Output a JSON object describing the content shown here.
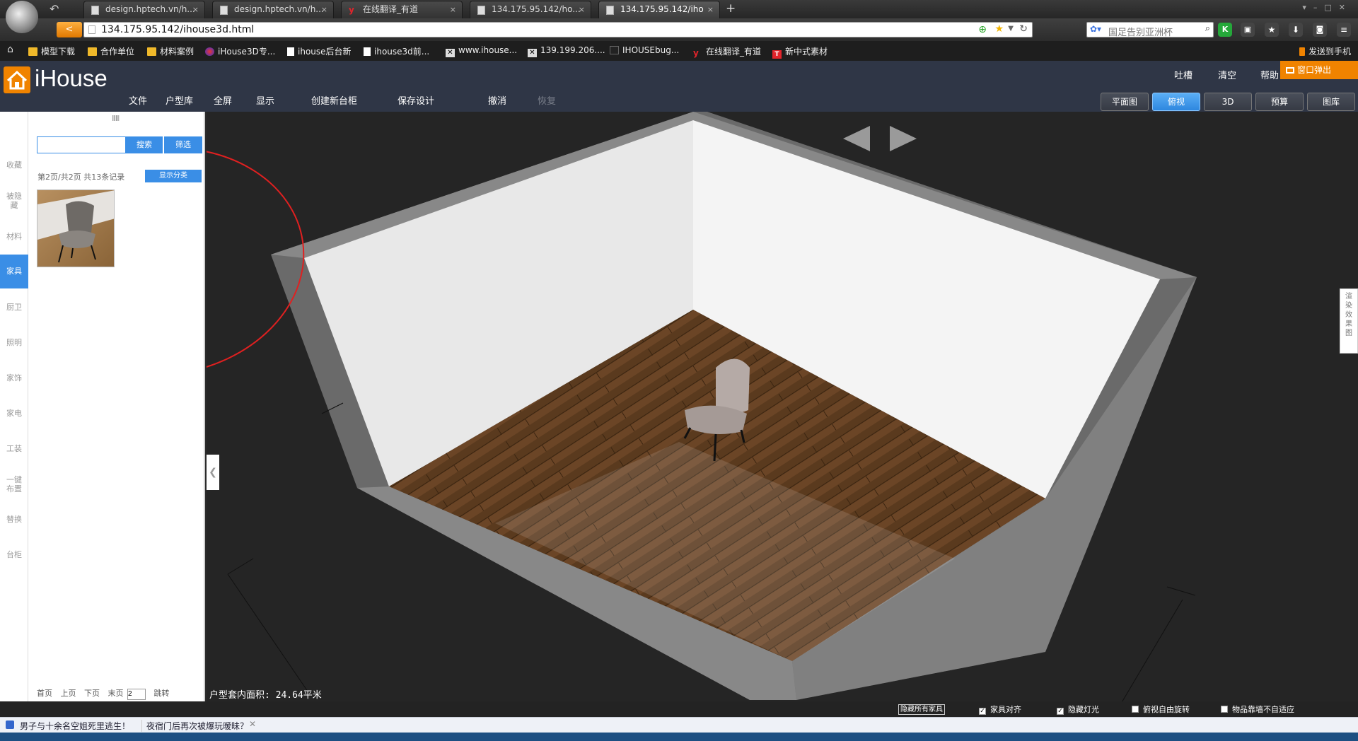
{
  "browser": {
    "tabs": [
      {
        "label": "design.hptech.vn/h..."
      },
      {
        "label": "design.hptech.vn/h..."
      },
      {
        "label": "在线翻译_有道"
      },
      {
        "label": "134.175.95.142/ho..."
      },
      {
        "label": "134.175.95.142/iho"
      }
    ],
    "close_glyph": "×",
    "new_tab_glyph": "+",
    "url": "134.175.95.142/ihouse3d.html",
    "search_placeholder": "国足告别亚洲杯",
    "bookmarks": [
      {
        "label": "模型下载",
        "icon": "folder-icon"
      },
      {
        "label": "合作单位",
        "icon": "folder-icon"
      },
      {
        "label": "材料案例",
        "icon": "folder-icon"
      },
      {
        "label": "iHouse3D专...",
        "icon": "site-icon"
      },
      {
        "label": "ihouse后台新",
        "icon": "page-icon"
      },
      {
        "label": "ihouse3d前...",
        "icon": "page-icon"
      },
      {
        "label": "www.ihouse...",
        "icon": "x-icon"
      },
      {
        "label": "139.199.206....",
        "icon": "x-icon"
      },
      {
        "label": "IHOUSEbug...",
        "icon": "bug-icon"
      },
      {
        "label": "在线翻译_有道",
        "icon": "youdao-icon"
      },
      {
        "label": "新中式素材",
        "icon": "t-icon"
      }
    ],
    "send_to_phone": "发送到手机"
  },
  "app": {
    "logo_text": "iHouse",
    "top_links": [
      "吐槽",
      "清空",
      "帮助"
    ],
    "popup_button": "窗口弹出",
    "menu": [
      "文件",
      "户型库",
      "全屏",
      "显示",
      "创建新台柜",
      "保存设计",
      "撤消",
      "恢复"
    ],
    "view_buttons": [
      "平面图",
      "俯视",
      "3D",
      "预算",
      "图库"
    ],
    "active_view": "俯视"
  },
  "left_tabs": [
    "收藏",
    "被隐藏",
    "材料",
    "家具",
    "厨卫",
    "照明",
    "家饰",
    "家电",
    "工装",
    "一键布置",
    "替换",
    "台柜"
  ],
  "active_left_tab": "家具",
  "panel": {
    "drag_handle": "||||||",
    "search_button": "搜索",
    "filter_button": "筛选",
    "page_info": "第2页/共2页 共13条记录",
    "show_category_button": "显示分类",
    "items": [
      {
        "name": "chair-thumbnail"
      }
    ],
    "pager": {
      "first": "首页",
      "prev": "上页",
      "next": "下页",
      "last": "末页",
      "page_value": "2",
      "go": "跳转"
    }
  },
  "viewport": {
    "area_label": "户型套内面积: 24.64平米",
    "render_tab": "渲染效果图"
  },
  "bottom": {
    "hide_all": "隐藏所有家具",
    "options": [
      {
        "label": "家具对齐",
        "checked": true
      },
      {
        "label": "隐藏灯光",
        "checked": true
      },
      {
        "label": "俯视自由旋转",
        "checked": false
      },
      {
        "label": "物品靠墙不自适应",
        "checked": false
      }
    ],
    "check_glyph": "✓"
  },
  "news": [
    "男子与十余名空姐死里逃生！",
    "夜宿门后再次被爆玩暧昧？"
  ],
  "colors": {
    "accent": "#3a8ee6",
    "brand_orange": "#f08300",
    "annotation_red": "#e02020"
  }
}
